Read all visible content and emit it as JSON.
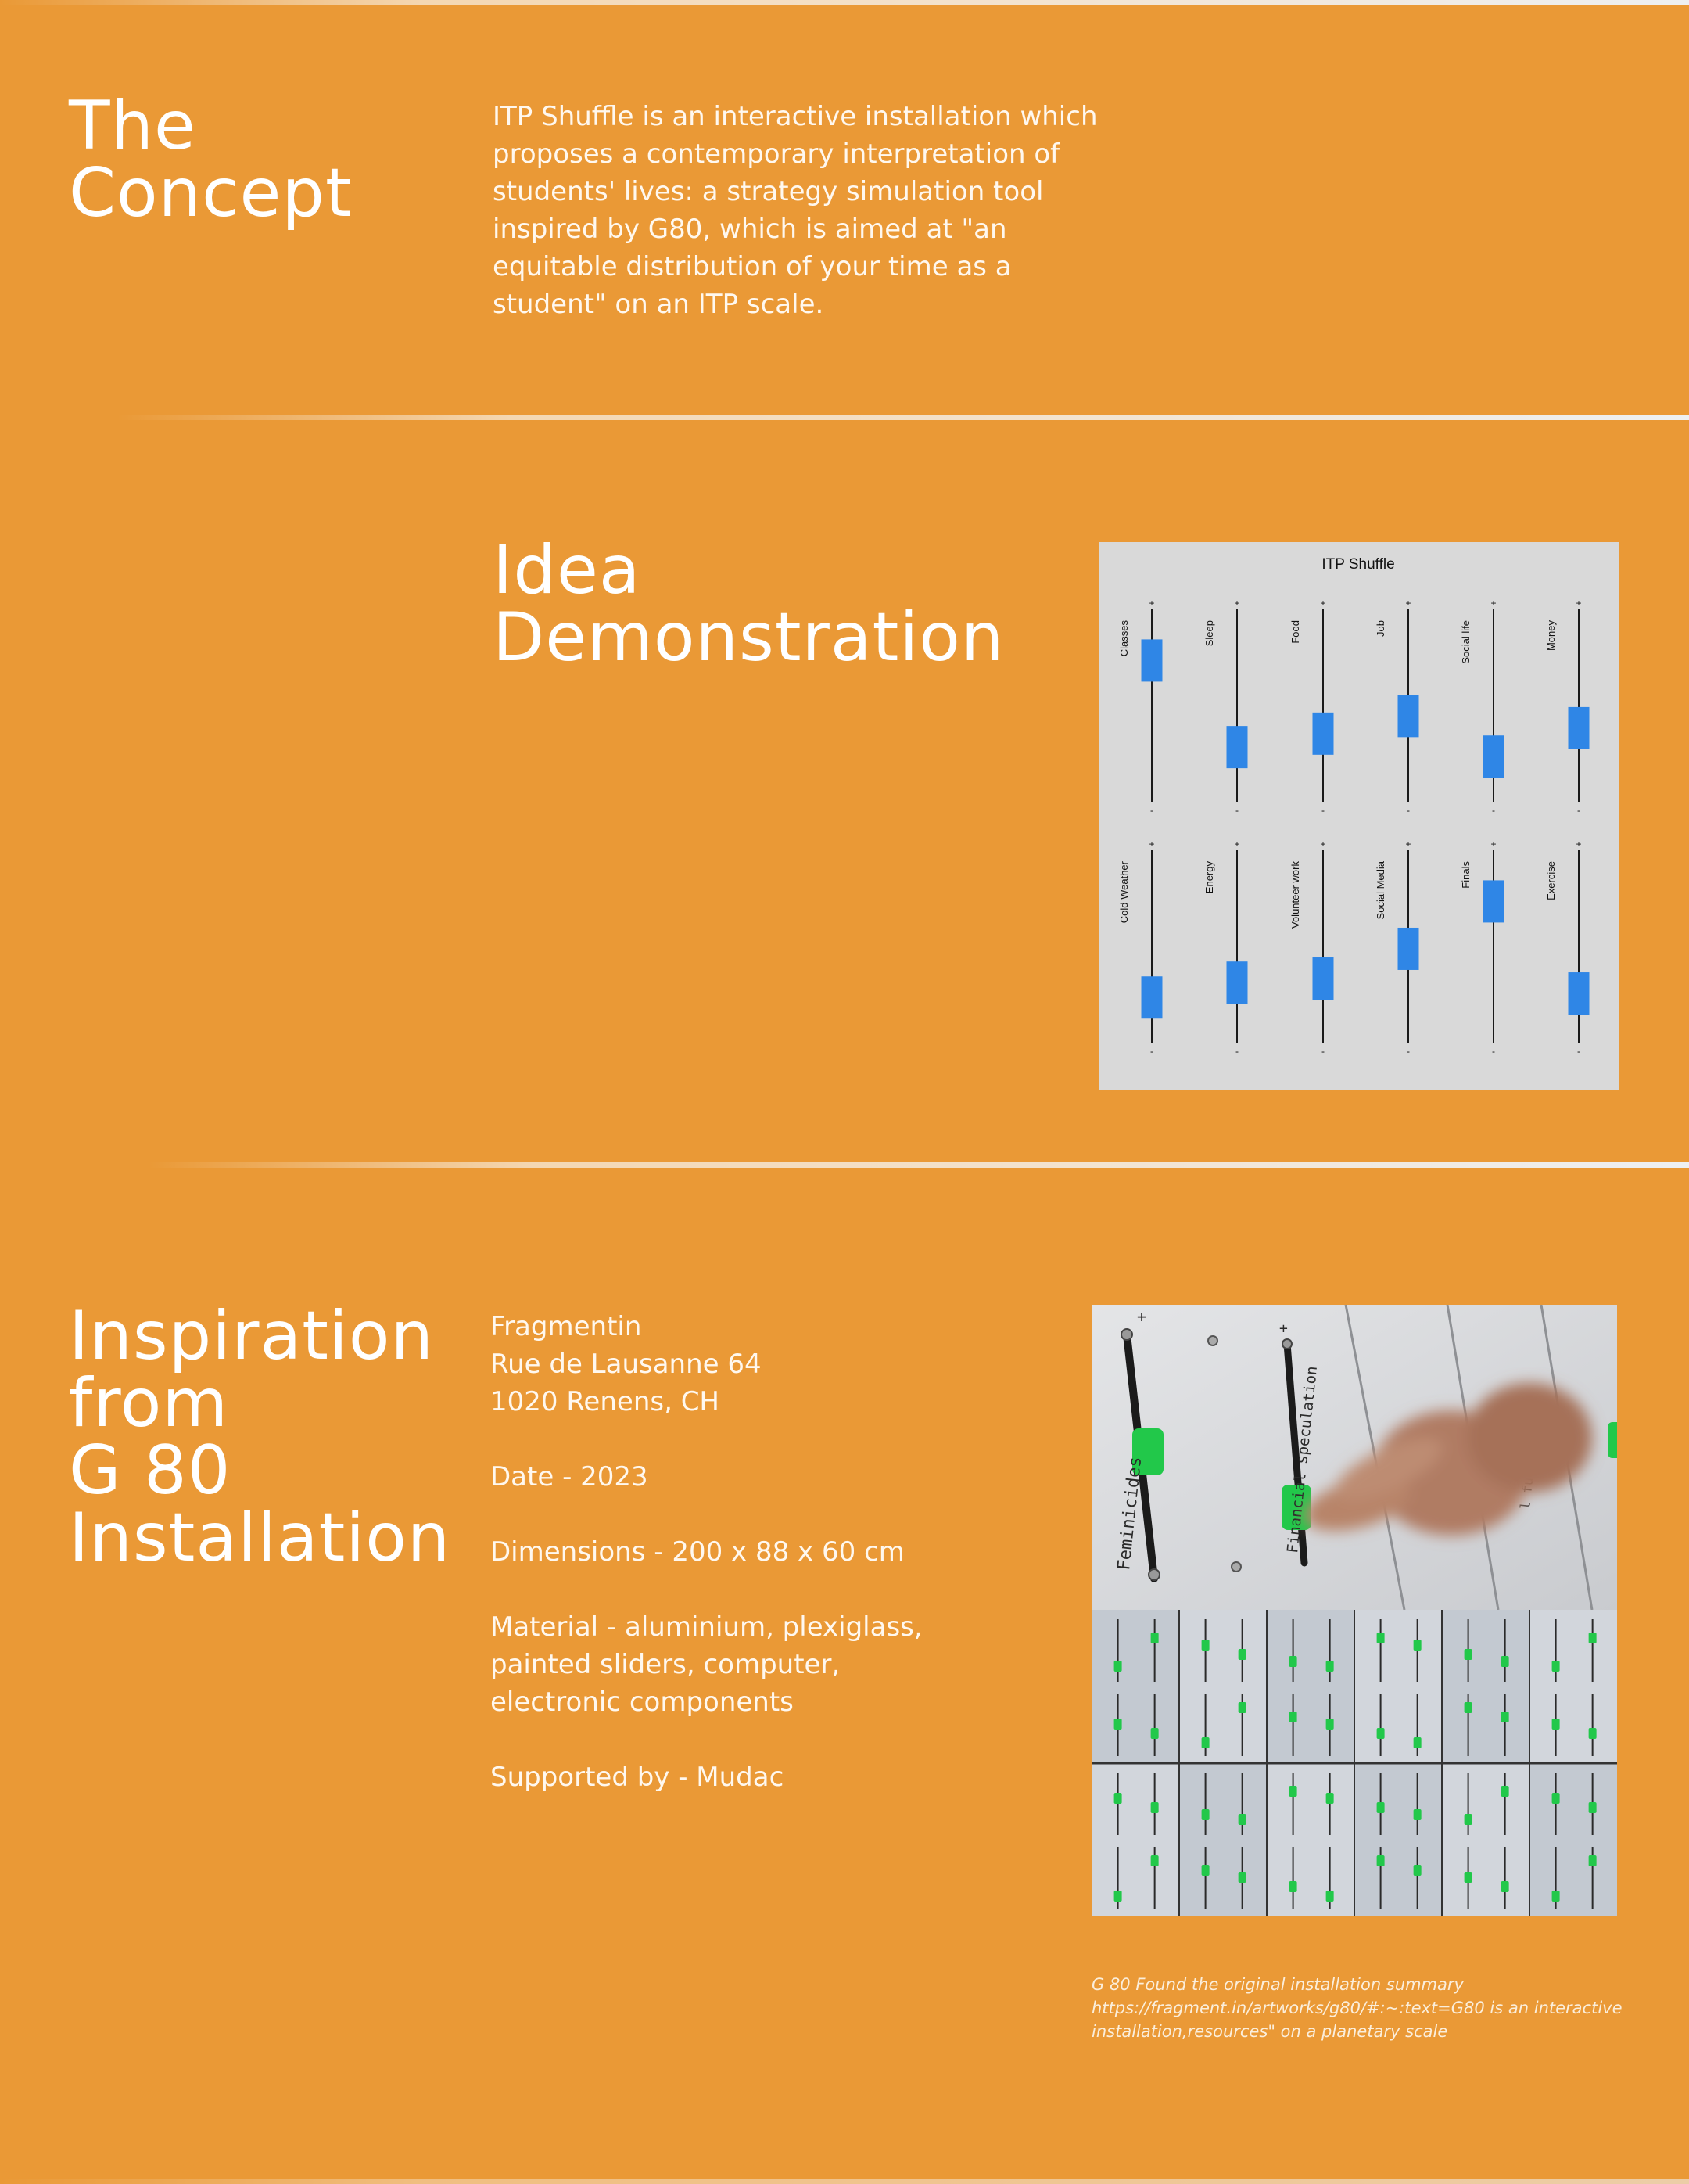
{
  "concept": {
    "heading": "The\nConcept",
    "body": "ITP Shuffle is an interactive installation which proposes a contemporary interpretation of students' lives: a strategy simulation tool inspired by G80, which is aimed at \"an equitable distribution of your time as a student\" on an ITP scale."
  },
  "idea": {
    "heading": "Idea\nDemonstration",
    "mockup": {
      "title": "ITP Shuffle",
      "plus_glyph": "+",
      "minus_glyph": "-",
      "slider_color": "#2F86E6",
      "panel_color": "#D9D9D9",
      "sliders": [
        {
          "label": "Classes",
          "level": 0.83
        },
        {
          "label": "Sleep",
          "level": 0.19
        },
        {
          "label": "Food",
          "level": 0.29
        },
        {
          "label": "Job",
          "level": 0.42
        },
        {
          "label": "Social life",
          "level": 0.12
        },
        {
          "label": "Money",
          "level": 0.33
        },
        {
          "label": "Cold Weather",
          "level": 0.12
        },
        {
          "label": "Energy",
          "level": 0.23
        },
        {
          "label": "Volunteer work",
          "level": 0.26
        },
        {
          "label": "Social Media",
          "level": 0.48
        },
        {
          "label": "Finals",
          "level": 0.83
        },
        {
          "label": "Exercise",
          "level": 0.15
        }
      ]
    }
  },
  "inspiration": {
    "heading": "Inspiration\nfrom\nG 80\nInstallation",
    "info": [
      "Fragmentin\nRue de Lausanne 64\n1020 Renens, CH",
      "Date - 2023",
      "Dimensions - 200 x 88 x 60 cm",
      "Material - aluminium, plexiglass,\npainted sliders, computer,\nelectronic components",
      "Supported by - Mudac"
    ],
    "photo_labels": {
      "slider_a": "Feminicides",
      "slider_b": "Financial speculation",
      "slider_c": "l fuel",
      "plus": "+",
      "minus": "-"
    },
    "caption": "G 80 Found the original installation summary\nhttps://fragment.in/artworks/g80/#:~:text=G80 is an interactive\ninstallation,resources\" on a planetary scale"
  },
  "colors": {
    "background": "#EA9936",
    "text": "#FFFFFF",
    "slider_knob": "#22C84A"
  }
}
